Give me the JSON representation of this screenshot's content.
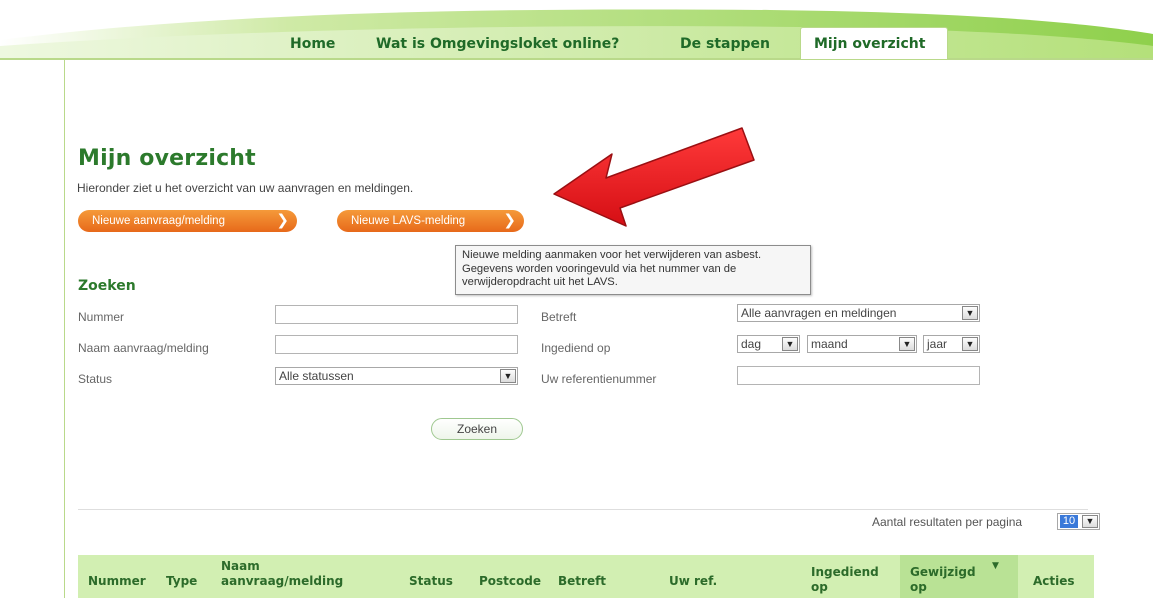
{
  "nav": {
    "tabs": [
      {
        "label": "Home"
      },
      {
        "label": "Wat is Omgevingsloket online?"
      },
      {
        "label": "De stappen"
      },
      {
        "label": "Mijn overzicht",
        "active": true
      }
    ]
  },
  "page": {
    "title": "Mijn overzicht",
    "intro": "Hieronder ziet u het overzicht van uw aanvragen en meldingen.",
    "btn_new_request": "Nieuwe aanvraag/melding",
    "btn_new_lavs": "Nieuwe LAVS-melding",
    "tooltip": "Nieuwe melding aanmaken voor het verwijderen van asbest. Gegevens worden vooringevuld via het nummer van de verwijderopdracht uit het LAVS."
  },
  "search": {
    "heading": "Zoeken",
    "labels": {
      "nummer": "Nummer",
      "naam": "Naam aanvraag/melding",
      "status": "Status",
      "betreft": "Betreft",
      "ingediend": "Ingediend op",
      "referentie": "Uw referentienummer"
    },
    "status_value": "Alle statussen",
    "betreft_value": "Alle aanvragen en meldingen",
    "date": {
      "day": "dag",
      "month": "maand",
      "year": "jaar"
    },
    "button": "Zoeken"
  },
  "results": {
    "per_page_label": "Aantal resultaten per pagina",
    "per_page_value": "10",
    "columns": [
      "Nummer",
      "Type",
      "Naam aanvraag/melding",
      "Status",
      "Postcode",
      "Betreft",
      "Uw ref.",
      "Ingediend op",
      "Gewijzigd op",
      "Acties"
    ]
  },
  "colors": {
    "accent_green": "#2c7a2c",
    "orange": "#e7691a",
    "table_header": "#d2efb2",
    "arrow_red": "#e8161b"
  },
  "icons": [
    "chevron-right-icon",
    "dropdown-arrow-icon",
    "sort-desc-icon",
    "red-arrow-annotation"
  ]
}
